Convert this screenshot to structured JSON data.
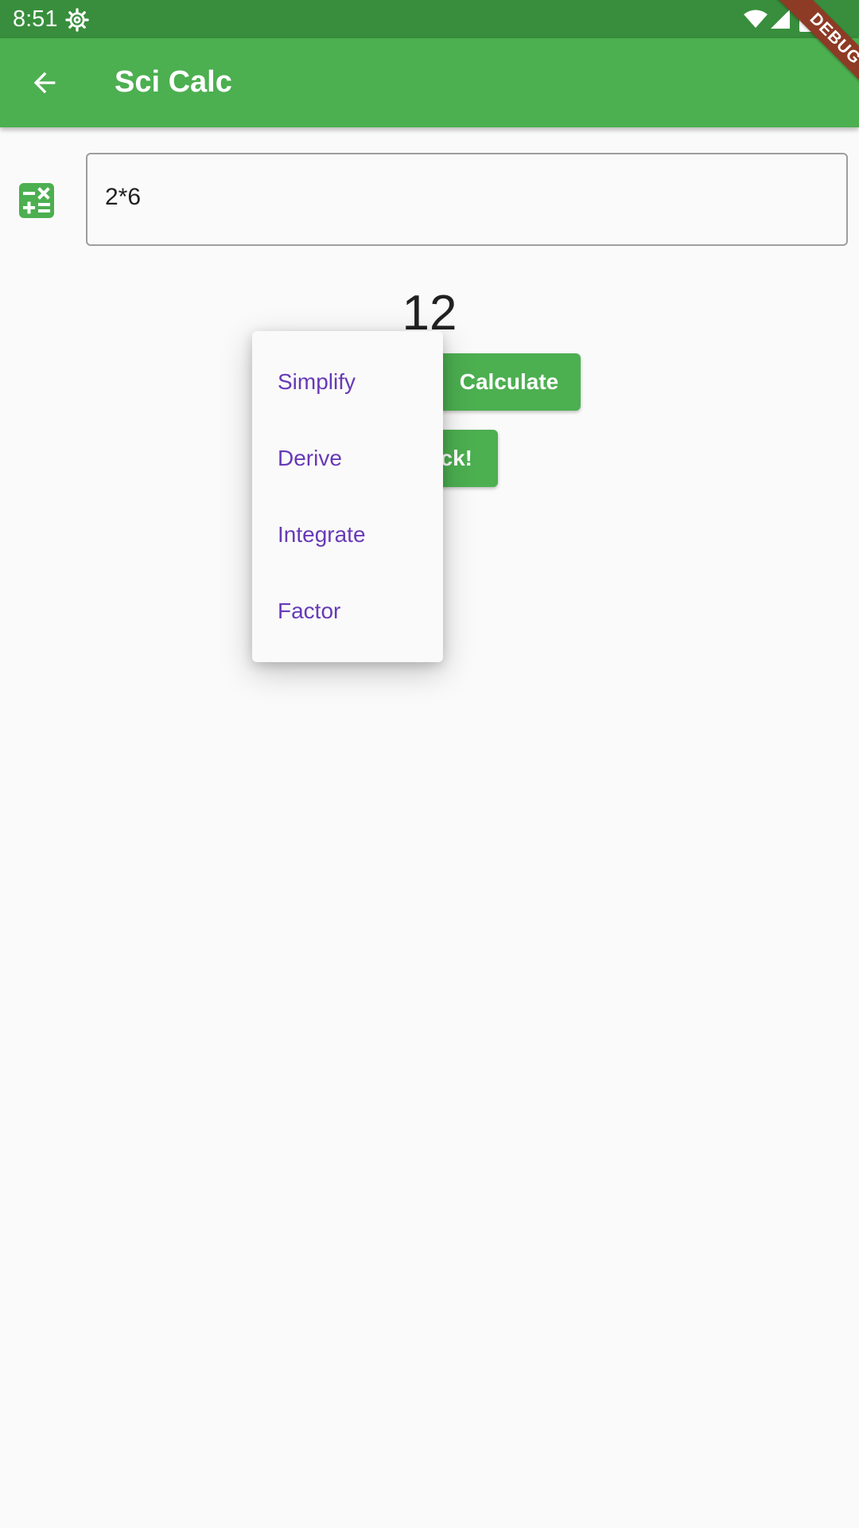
{
  "status_bar": {
    "time": "8:51",
    "icons": [
      "settings-gear-icon",
      "wifi-icon",
      "cell-signal-icon",
      "battery-icon"
    ]
  },
  "app_bar": {
    "title": "Sci Calc",
    "back_icon": "arrow-back-icon",
    "background_color": "#4caf50",
    "status_color": "#388e3c"
  },
  "debug_banner": {
    "label": "DEBUG"
  },
  "expression": {
    "icon": "calculator-icon",
    "value": "2*6"
  },
  "result": {
    "value": "12"
  },
  "buttons": {
    "calculate_label": "Calculate",
    "second_label_visible": "ck!"
  },
  "menu": {
    "items": [
      {
        "label": "Simplify"
      },
      {
        "label": "Derive"
      },
      {
        "label": "Integrate"
      },
      {
        "label": "Factor"
      }
    ],
    "text_color": "#673ab7"
  }
}
